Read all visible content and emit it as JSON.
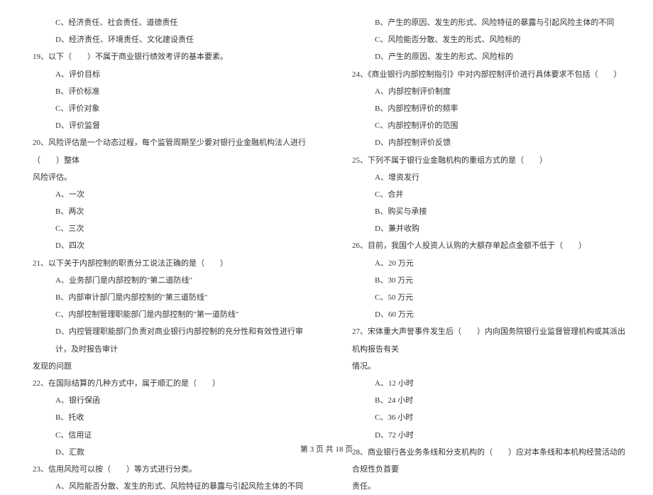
{
  "left": {
    "q18_c": "C、经济责任、社会责任、道德责任",
    "q18_d": "D、经济责任、环境责任、文化建设责任",
    "q19": "19、以下（　　）不属于商业银行绩效考评的基本要素。",
    "q19_a": "A、评价目标",
    "q19_b": "B、评价标准",
    "q19_c": "C、评价对象",
    "q19_d": "D、评价监督",
    "q20": "20、风险评估是一个动态过程，每个监管周期至少要对银行业金融机构法人进行（　　）整体",
    "q20_cont": "风险评估。",
    "q20_a": "A、一次",
    "q20_b": "B、两次",
    "q20_c": "C、三次",
    "q20_d": "D、四次",
    "q21": "21、以下关于内部控制的职责分工说法正确的是（　　）",
    "q21_a": "A、业务部门是内部控制的\"第二道防线\"",
    "q21_b": "B、内部审计部门是内部控制的\"第三道防线\"",
    "q21_c": "C、内部控制管理职能部门是内部控制的\"第一道防线\"",
    "q21_d": "D、内控管理职能部门负责对商业银行内部控制的充分性和有效性进行审计，及时报告审计",
    "q21_d_cont": "发现的问题",
    "q22": "22、在国际结算的几种方式中，属于顺汇的是（　　）",
    "q22_a": "A、银行保函",
    "q22_b": "B、托收",
    "q22_c": "C、信用证",
    "q22_d": "D、汇款",
    "q23": "23、信用风险可以按（　　）等方式进行分类。",
    "q23_a": "A、风险能否分散、发生的形式、风险特征的暴露与引起风险主体的不同"
  },
  "right": {
    "q23_b": "B、产生的原因、发生的形式、风险特征的暴露与引起风险主体的不同",
    "q23_c": "C、风险能否分散、发生的形式、风险标的",
    "q23_d": "D、产生的原因、发生的形式、风险标的",
    "q24": "24、《商业银行内部控制指引》中对内部控制评价进行具体要求不包括（　　）",
    "q24_a": "A、内部控制评价制度",
    "q24_b": "B、内部控制评价的频率",
    "q24_c": "C、内部控制评价的范围",
    "q24_d": "D、内部控制评价反馈",
    "q25": "25、下列不属于银行业金融机构的重组方式的是（　　）",
    "q25_a": "A、增资发行",
    "q25_c": "C、合并",
    "q25_b": "B、购买与承接",
    "q25_d": "D、兼并收购",
    "q26": "26、目前，我国个人投资人认购的大额存单起点金额不低于（　　）",
    "q26_a": "A、20 万元",
    "q26_b": "B、30 万元",
    "q26_c": "C、50 万元",
    "q26_d": "D、60 万元",
    "q27": "27、宋体重大声誉事件发生后（　　）内向国务院银行业监督管理机构或其派出机构报告有关",
    "q27_cont": "情况。",
    "q27_a": "A、12 小时",
    "q27_b": "B、24 小时",
    "q27_c": "C、36 小时",
    "q27_d": "D、72 小时",
    "q28": "28、商业银行各业务条线和分支机构的（　　）应对本条线和本机构经营活动的合规性负首要",
    "q28_cont": "责任。"
  },
  "footer": "第 3 页 共 18 页"
}
